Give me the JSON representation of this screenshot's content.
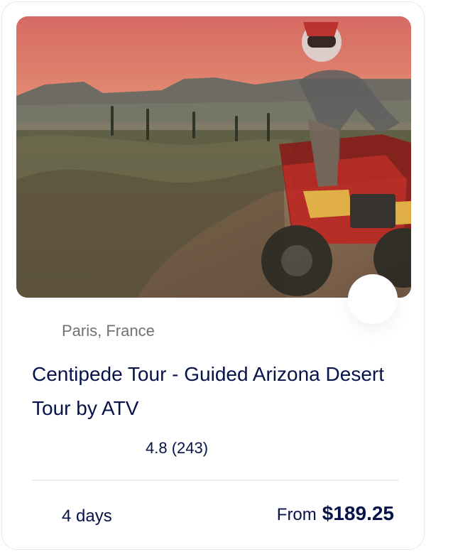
{
  "card": {
    "image_alt": "ATV rider on desert dirt trail",
    "location": "Paris, France",
    "title": "Centipede Tour - Guided Arizona Desert Tour by ATV",
    "rating_text": "4.8 (243)",
    "duration": "4 days",
    "price_prefix": "From",
    "price_value": "$189.25"
  },
  "colors": {
    "text": "#06134a",
    "muted": "#717171",
    "border": "#e8e8ec"
  },
  "icons": {
    "favorite": "heart-icon",
    "location": "map-pin-icon",
    "rating": "star-icon",
    "duration": "clock-icon"
  }
}
